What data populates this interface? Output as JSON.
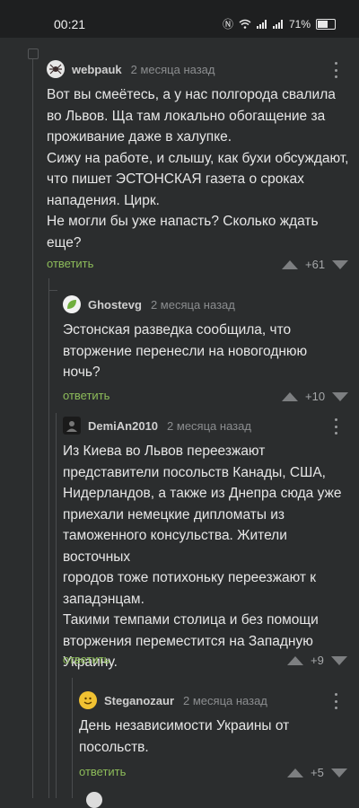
{
  "status_bar": {
    "time": "00:21",
    "battery": "71%",
    "battery_level": 0.71
  },
  "comments": [
    {
      "author": "webpauk",
      "date": "2 месяца назад",
      "text": "Вот вы смеётесь, а у нас полгорода свалила\nво Львов. Ща там локально обогащение за\nпроживание даже в халупке.\nСижу на работе, и слышу, как бухи обсуждают,\nчто пишет ЭСТОНСКАЯ газета о сроках\nнападения. Цирк.\nНе могли бы уже напасть? Сколько ждать\nеще?",
      "reply_label": "ответить",
      "score": "+61",
      "avatar_icon": "spider-avatar-icon"
    },
    {
      "author": "Ghostevg",
      "date": "2 месяца назад",
      "text": "Эстонская разведка сообщила, что\nвторжение перенесли на новогоднюю\nночь?",
      "reply_label": "ответить",
      "score": "+10",
      "avatar_icon": "leaf-avatar-icon"
    },
    {
      "author": "DemiAn2010",
      "date": "2 месяца назад",
      "text": "Из Киева во Львов переезжают\nпредставители посольств Канады, США,\nНидерландов, а также из Днепра сюда уже\nприехали немецкие дипломаты из\nтаможенного консульства. Жители восточных\nгородов тоже потихоньку переезжают к\nзападэнцам.\nТакими темпами столица и без помощи\nвторжения переместится на Западную\nУкраину.",
      "reply_label": "ответить",
      "score": "+9",
      "avatar_icon": "dark-avatar-icon"
    },
    {
      "author": "Steganozaur",
      "date": "2 месяца назад",
      "text": "День независимости Украины от\nпосольств.",
      "reply_label": "ответить",
      "score": "+5",
      "avatar_icon": "smiley-avatar-icon"
    }
  ],
  "colors": {
    "background": "#2b2d2e",
    "reply_link": "#8dbc5a",
    "vote_arrow": "#7d7f81"
  }
}
